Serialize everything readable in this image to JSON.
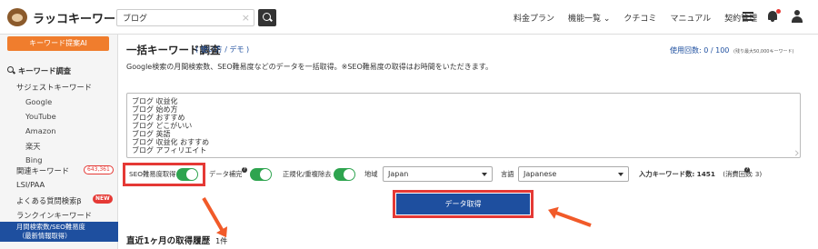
{
  "header": {
    "logo_text": "ラッコキーワード",
    "search_value": "ブログ",
    "search_clear": "×",
    "nav": [
      "料金プラン",
      "機能一覧 ⌄",
      "クチコミ",
      "マニュアル",
      "契約管理"
    ]
  },
  "sidebar": {
    "ai_button": "キーワード提案AI",
    "section_title": "キーワード調査",
    "items": {
      "suggest": "サジェストキーワード",
      "google": "Google",
      "youtube": "YouTube",
      "amazon": "Amazon",
      "rakuten": "楽天",
      "bing": "Bing",
      "related": "関連キーワード",
      "related_badge": "643,361",
      "lsi": "LSI/PAA",
      "faq": "よくある質問検索β",
      "faq_badge": "NEW",
      "rankin": "ランクインキーワード",
      "monthly_1": "月間検索数/SEO難易度",
      "monthly_2": "（最新情報取得）"
    }
  },
  "main": {
    "title": "一括キーワード調査",
    "howto": "( 使い方 / デモ )",
    "usage": "使用回数: 0 / 100",
    "usage_note": "(残り最大50,000キーワード)",
    "description": "Google検索の月間検索数、SEO難易度などのデータを一括取得。※SEO難易度の取得はお時間をいただきます。",
    "keywords": [
      "ブログ 収益化",
      "ブログ 始め方",
      "ブログ おすすめ",
      "ブログ どこがいい",
      "ブログ 英語",
      "ブログ 収益化 おすすめ",
      "ブログ アフィリエイト"
    ],
    "options": {
      "seo_label": "SEO難易度取得",
      "complement_label": "データ補完",
      "help_mark": "?",
      "normalize_label": "正規化/重複除去",
      "region_label": "地域",
      "region_value": "Japan",
      "language_label": "言語",
      "language_value": "Japanese",
      "kw_count_label": "入力キーワード数:",
      "kw_count_value": "1451",
      "cost_label": "(消費回数",
      "cost_value": ": 3)"
    },
    "get_button": "データ取得",
    "history_title": "直近1ヶ月の取得履歴",
    "history_count": "1件"
  },
  "colors": {
    "accent": "#1e4f9f",
    "ai_button": "#f07d2d",
    "toggle_on": "#2ea44f",
    "annotation": "#e53935",
    "arrow": "#f15a29"
  },
  "icons": [
    "logo-icon",
    "search-icon",
    "clear-icon",
    "menu-icon",
    "bell-icon",
    "user-icon",
    "magnifier-icon",
    "help-icon",
    "chevron-down-icon",
    "arrow-icon"
  ]
}
